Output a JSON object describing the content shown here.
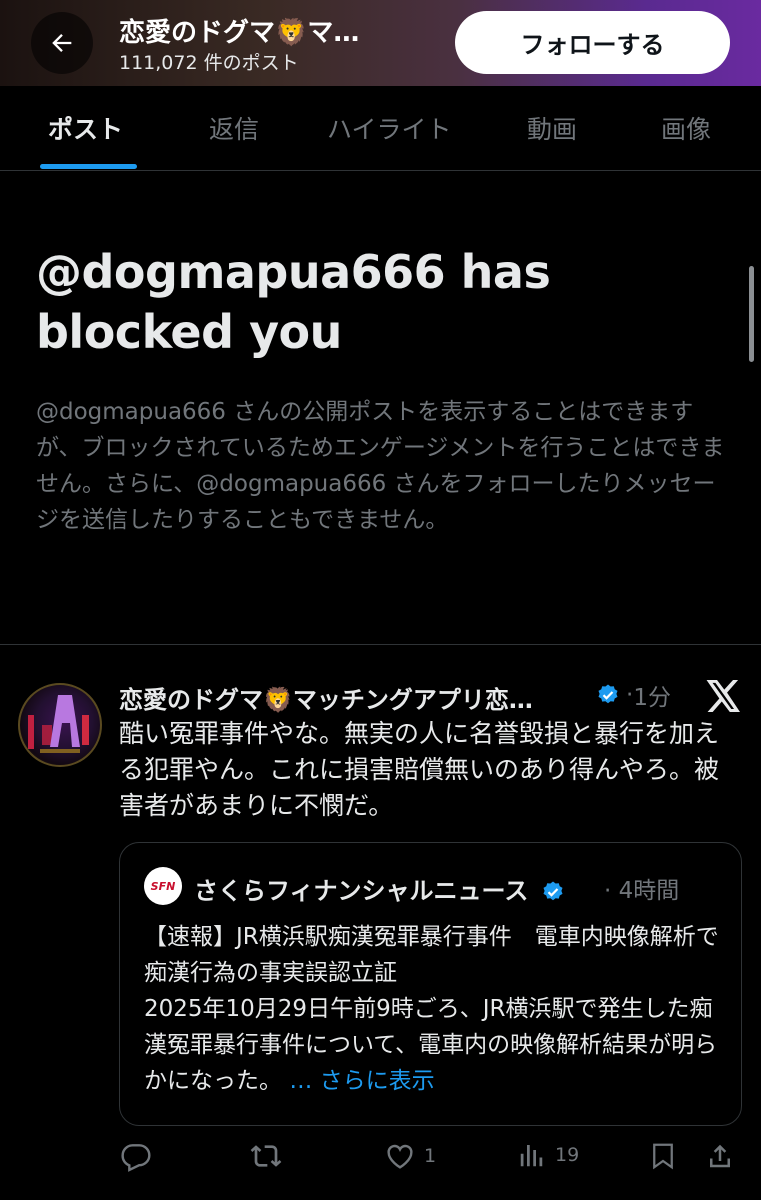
{
  "header": {
    "title": "恋愛のドグマ🦁マ…",
    "subtitle": "111,072 件のポスト",
    "follow_label": "フォローする"
  },
  "tabs": [
    {
      "label": "ポスト",
      "active": true
    },
    {
      "label": "返信",
      "active": false
    },
    {
      "label": "ハイライト",
      "active": false
    },
    {
      "label": "動画",
      "active": false
    },
    {
      "label": "画像",
      "active": false
    }
  ],
  "block_notice": {
    "title": "@dogmapua666 has blocked you",
    "description": "@dogmapua666 さんの公開ポストを表示することはできますが、ブロックされているためエンゲージメントを行うことはできません。さらに、@dogmapua666 さんをフォローしたりメッセージを送信したりすることもできません。"
  },
  "post": {
    "author_name": "恋愛のドグマ🦁マッチングアプリ恋…",
    "time": "1分",
    "text": "酷い冤罪事件やな。無実の人に名誉毀損と暴行を加える犯罪やん。これに損害賠償無いのあり得んやろ。被害者があまりに不憫だ。",
    "quote": {
      "logo_text": "SFN",
      "author_name": "さくらフィナンシャルニュース",
      "time": "4時間",
      "text": "【速報】JR横浜駅痴漢冤罪暴行事件　電車内映像解析で痴漢行為の事実誤認立証\n2025年10月29日午前9時ごろ、JR横浜駅で発生した痴漢冤罪暴行事件について、電車内の映像解析結果が明らかになった。",
      "show_more": "… さらに表示"
    },
    "actions": {
      "replies": "",
      "reposts": "",
      "likes": "1",
      "views": "19"
    }
  },
  "colors": {
    "accent": "#1d9bf0",
    "muted": "#71767b",
    "background": "#000000"
  }
}
